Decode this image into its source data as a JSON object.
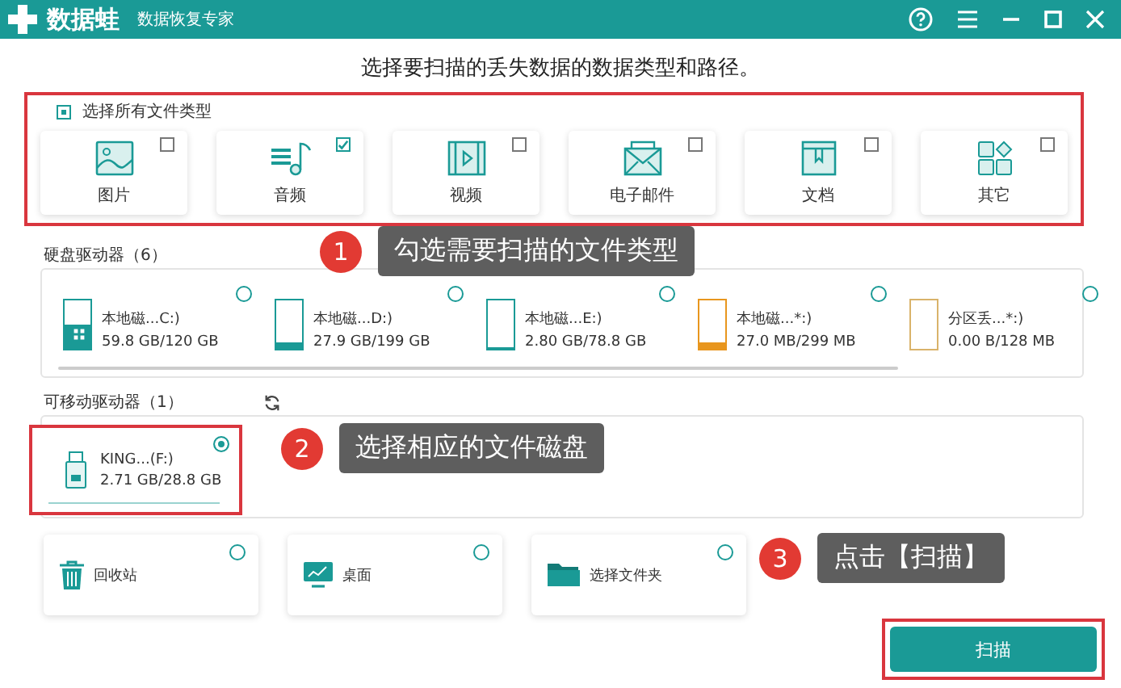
{
  "titlebar": {
    "logo": "数据蛙",
    "subtitle": "数据恢复专家"
  },
  "heading": "选择要扫描的丢失数据的数据类型和路径。",
  "file_types": {
    "select_all": {
      "label": "选择所有文件类型",
      "indeterminate": true
    },
    "items": [
      {
        "kind": "image",
        "label": "图片",
        "checked": false
      },
      {
        "kind": "audio",
        "label": "音频",
        "checked": true
      },
      {
        "kind": "video",
        "label": "视频",
        "checked": false
      },
      {
        "kind": "email",
        "label": "电子邮件",
        "checked": false
      },
      {
        "kind": "document",
        "label": "文档",
        "checked": false
      },
      {
        "kind": "other",
        "label": "其它",
        "checked": false
      }
    ]
  },
  "hard_drives": {
    "title": "硬盘驱动器（6）",
    "items": [
      {
        "name": "本地磁...C:)",
        "size": "59.8 GB/120 GB",
        "level": 0.5,
        "color": "#1a9a96",
        "system": true,
        "selected": false
      },
      {
        "name": "本地磁...D:)",
        "size": "27.9 GB/199 GB",
        "level": 0.14,
        "color": "#1a9a96",
        "system": false,
        "selected": false
      },
      {
        "name": "本地磁...E:)",
        "size": "2.80 GB/78.8 GB",
        "level": 0.04,
        "color": "#1a9a96",
        "system": false,
        "selected": false
      },
      {
        "name": "本地磁...*:)",
        "size": "27.0 MB/299 MB",
        "level": 0.14,
        "color": "#e8961e",
        "system": false,
        "selected": false
      },
      {
        "name": "分区丢...*:)",
        "size": "0.00  B/128 MB",
        "level": 0,
        "color": "#d9b36a",
        "system": false,
        "selected": false
      }
    ]
  },
  "removable_drives": {
    "title": "可移动驱动器（1）",
    "items": [
      {
        "name": "KING...(F:)",
        "size": "2.71 GB/28.8 GB",
        "selected": true
      }
    ]
  },
  "locations": [
    {
      "kind": "recycle",
      "label": "回收站",
      "selected": false
    },
    {
      "kind": "desktop",
      "label": "桌面",
      "selected": false
    },
    {
      "kind": "folder",
      "label": "选择文件夹",
      "selected": false
    }
  ],
  "scan_button": "扫描",
  "annotations": [
    {
      "number": "1",
      "text": "勾选需要扫描的文件类型"
    },
    {
      "number": "2",
      "text": "选择相应的文件磁盘"
    },
    {
      "number": "3",
      "text": "点击【扫描】"
    }
  ]
}
